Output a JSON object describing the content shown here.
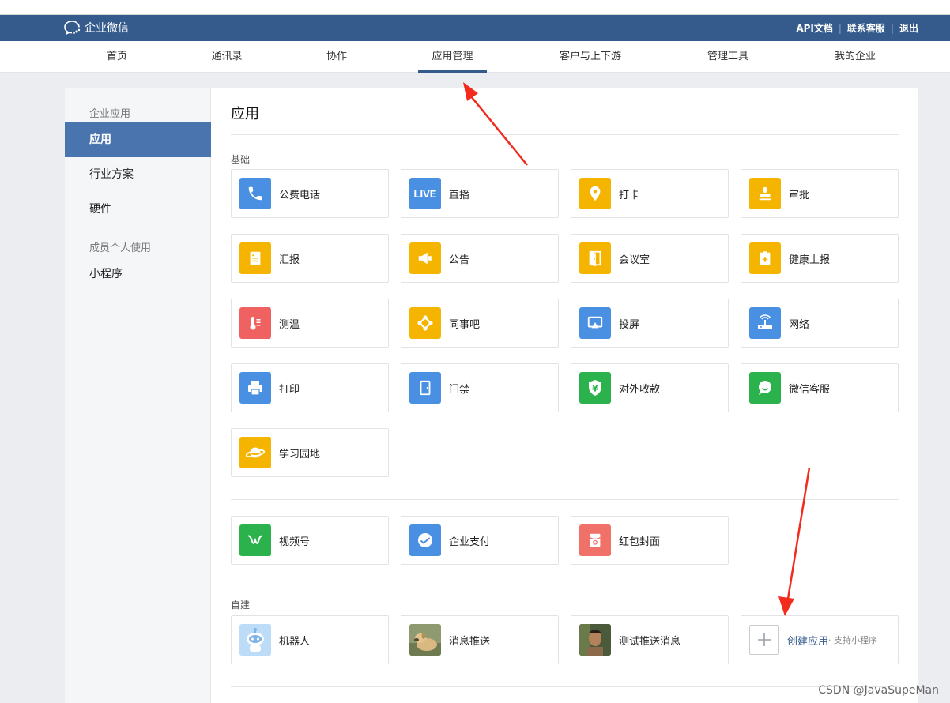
{
  "header": {
    "logo_text": "企业微信",
    "links": [
      "API文档",
      "联系客服",
      "退出"
    ]
  },
  "nav": {
    "items": [
      "首页",
      "通讯录",
      "协作",
      "应用管理",
      "客户与上下游",
      "管理工具",
      "我的企业"
    ],
    "active": "应用管理"
  },
  "sidebar": {
    "group1": "企业应用",
    "items": [
      "应用",
      "行业方案",
      "硬件"
    ],
    "group2": "成员个人使用",
    "item_mini": "小程序"
  },
  "main": {
    "title": "应用",
    "basic_label": "基础",
    "basic_apps": [
      {
        "label": "公费电话",
        "icon": "phone-icon",
        "color": "#4a90e2"
      },
      {
        "label": "直播",
        "icon": "live-icon",
        "color": "#4a90e2"
      },
      {
        "label": "打卡",
        "icon": "location-pin-icon",
        "color": "#f5b400"
      },
      {
        "label": "审批",
        "icon": "stamp-icon",
        "color": "#f5b400"
      },
      {
        "label": "汇报",
        "icon": "report-icon",
        "color": "#f5b400"
      },
      {
        "label": "公告",
        "icon": "megaphone-icon",
        "color": "#f5b400"
      },
      {
        "label": "会议室",
        "icon": "door-open-icon",
        "color": "#f5b400"
      },
      {
        "label": "健康上报",
        "icon": "health-clipboard-icon",
        "color": "#f5b400"
      },
      {
        "label": "测温",
        "icon": "thermometer-icon",
        "color": "#f06262"
      },
      {
        "label": "同事吧",
        "icon": "colleague-hub-icon",
        "color": "#f5b400"
      },
      {
        "label": "投屏",
        "icon": "screen-cast-icon",
        "color": "#4a90e2"
      },
      {
        "label": "网络",
        "icon": "router-icon",
        "color": "#4a90e2"
      },
      {
        "label": "打印",
        "icon": "printer-icon",
        "color": "#4a90e2"
      },
      {
        "label": "门禁",
        "icon": "door-icon",
        "color": "#4a90e2"
      },
      {
        "label": "对外收款",
        "icon": "yuan-shield-icon",
        "color": "#2bb24c"
      },
      {
        "label": "微信客服",
        "icon": "chat-bubble-icon",
        "color": "#2bb24c"
      },
      {
        "label": "学习园地",
        "icon": "planet-icon",
        "color": "#f5b400"
      }
    ],
    "other_apps": [
      {
        "label": "视频号",
        "icon": "channels-icon",
        "color": "#2bb24c"
      },
      {
        "label": "企业支付",
        "icon": "payment-icon",
        "color": "#4a90e2"
      },
      {
        "label": "红包封面",
        "icon": "red-packet-icon",
        "color": "#f07167"
      }
    ],
    "custom_label": "自建",
    "custom_apps": [
      {
        "label": "机器人",
        "icon": "robot-icon",
        "color": "#bcdcf7"
      },
      {
        "label": "消息推送",
        "icon": "dog-photo-icon",
        "color": "#9a8a6a"
      },
      {
        "label": "测试推送消息",
        "icon": "person-photo-icon",
        "color": "#5a6a4a"
      }
    ],
    "create": {
      "label": "创建应用",
      "sub": "· 支持小程序"
    }
  },
  "watermark": "CSDN @JavaSupeMan"
}
